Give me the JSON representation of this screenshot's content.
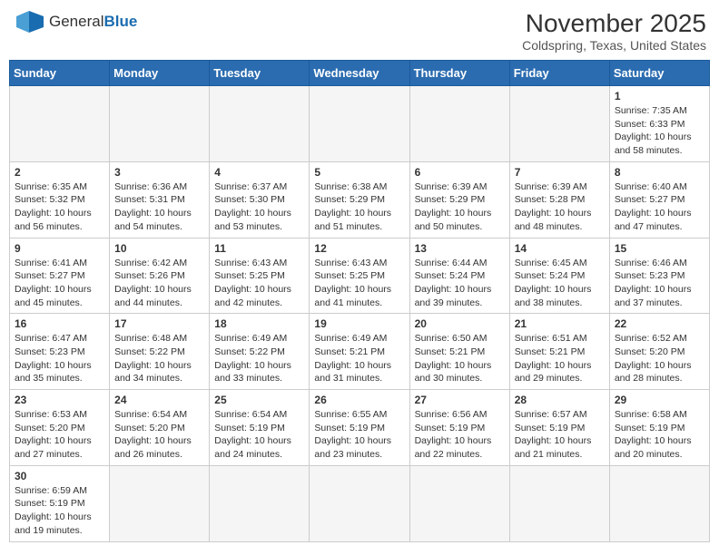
{
  "header": {
    "logo_general": "General",
    "logo_blue": "Blue",
    "month_title": "November 2025",
    "location": "Coldspring, Texas, United States"
  },
  "days_of_week": [
    "Sunday",
    "Monday",
    "Tuesday",
    "Wednesday",
    "Thursday",
    "Friday",
    "Saturday"
  ],
  "weeks": [
    [
      {
        "day": "",
        "info": ""
      },
      {
        "day": "",
        "info": ""
      },
      {
        "day": "",
        "info": ""
      },
      {
        "day": "",
        "info": ""
      },
      {
        "day": "",
        "info": ""
      },
      {
        "day": "",
        "info": ""
      },
      {
        "day": "1",
        "info": "Sunrise: 7:35 AM\nSunset: 6:33 PM\nDaylight: 10 hours\nand 58 minutes."
      }
    ],
    [
      {
        "day": "2",
        "info": "Sunrise: 6:35 AM\nSunset: 5:32 PM\nDaylight: 10 hours\nand 56 minutes."
      },
      {
        "day": "3",
        "info": "Sunrise: 6:36 AM\nSunset: 5:31 PM\nDaylight: 10 hours\nand 54 minutes."
      },
      {
        "day": "4",
        "info": "Sunrise: 6:37 AM\nSunset: 5:30 PM\nDaylight: 10 hours\nand 53 minutes."
      },
      {
        "day": "5",
        "info": "Sunrise: 6:38 AM\nSunset: 5:29 PM\nDaylight: 10 hours\nand 51 minutes."
      },
      {
        "day": "6",
        "info": "Sunrise: 6:39 AM\nSunset: 5:29 PM\nDaylight: 10 hours\nand 50 minutes."
      },
      {
        "day": "7",
        "info": "Sunrise: 6:39 AM\nSunset: 5:28 PM\nDaylight: 10 hours\nand 48 minutes."
      },
      {
        "day": "8",
        "info": "Sunrise: 6:40 AM\nSunset: 5:27 PM\nDaylight: 10 hours\nand 47 minutes."
      }
    ],
    [
      {
        "day": "9",
        "info": "Sunrise: 6:41 AM\nSunset: 5:27 PM\nDaylight: 10 hours\nand 45 minutes."
      },
      {
        "day": "10",
        "info": "Sunrise: 6:42 AM\nSunset: 5:26 PM\nDaylight: 10 hours\nand 44 minutes."
      },
      {
        "day": "11",
        "info": "Sunrise: 6:43 AM\nSunset: 5:25 PM\nDaylight: 10 hours\nand 42 minutes."
      },
      {
        "day": "12",
        "info": "Sunrise: 6:43 AM\nSunset: 5:25 PM\nDaylight: 10 hours\nand 41 minutes."
      },
      {
        "day": "13",
        "info": "Sunrise: 6:44 AM\nSunset: 5:24 PM\nDaylight: 10 hours\nand 39 minutes."
      },
      {
        "day": "14",
        "info": "Sunrise: 6:45 AM\nSunset: 5:24 PM\nDaylight: 10 hours\nand 38 minutes."
      },
      {
        "day": "15",
        "info": "Sunrise: 6:46 AM\nSunset: 5:23 PM\nDaylight: 10 hours\nand 37 minutes."
      }
    ],
    [
      {
        "day": "16",
        "info": "Sunrise: 6:47 AM\nSunset: 5:23 PM\nDaylight: 10 hours\nand 35 minutes."
      },
      {
        "day": "17",
        "info": "Sunrise: 6:48 AM\nSunset: 5:22 PM\nDaylight: 10 hours\nand 34 minutes."
      },
      {
        "day": "18",
        "info": "Sunrise: 6:49 AM\nSunset: 5:22 PM\nDaylight: 10 hours\nand 33 minutes."
      },
      {
        "day": "19",
        "info": "Sunrise: 6:49 AM\nSunset: 5:21 PM\nDaylight: 10 hours\nand 31 minutes."
      },
      {
        "day": "20",
        "info": "Sunrise: 6:50 AM\nSunset: 5:21 PM\nDaylight: 10 hours\nand 30 minutes."
      },
      {
        "day": "21",
        "info": "Sunrise: 6:51 AM\nSunset: 5:21 PM\nDaylight: 10 hours\nand 29 minutes."
      },
      {
        "day": "22",
        "info": "Sunrise: 6:52 AM\nSunset: 5:20 PM\nDaylight: 10 hours\nand 28 minutes."
      }
    ],
    [
      {
        "day": "23",
        "info": "Sunrise: 6:53 AM\nSunset: 5:20 PM\nDaylight: 10 hours\nand 27 minutes."
      },
      {
        "day": "24",
        "info": "Sunrise: 6:54 AM\nSunset: 5:20 PM\nDaylight: 10 hours\nand 26 minutes."
      },
      {
        "day": "25",
        "info": "Sunrise: 6:54 AM\nSunset: 5:19 PM\nDaylight: 10 hours\nand 24 minutes."
      },
      {
        "day": "26",
        "info": "Sunrise: 6:55 AM\nSunset: 5:19 PM\nDaylight: 10 hours\nand 23 minutes."
      },
      {
        "day": "27",
        "info": "Sunrise: 6:56 AM\nSunset: 5:19 PM\nDaylight: 10 hours\nand 22 minutes."
      },
      {
        "day": "28",
        "info": "Sunrise: 6:57 AM\nSunset: 5:19 PM\nDaylight: 10 hours\nand 21 minutes."
      },
      {
        "day": "29",
        "info": "Sunrise: 6:58 AM\nSunset: 5:19 PM\nDaylight: 10 hours\nand 20 minutes."
      }
    ],
    [
      {
        "day": "30",
        "info": "Sunrise: 6:59 AM\nSunset: 5:19 PM\nDaylight: 10 hours\nand 19 minutes."
      },
      {
        "day": "",
        "info": ""
      },
      {
        "day": "",
        "info": ""
      },
      {
        "day": "",
        "info": ""
      },
      {
        "day": "",
        "info": ""
      },
      {
        "day": "",
        "info": ""
      },
      {
        "day": "",
        "info": ""
      }
    ]
  ]
}
